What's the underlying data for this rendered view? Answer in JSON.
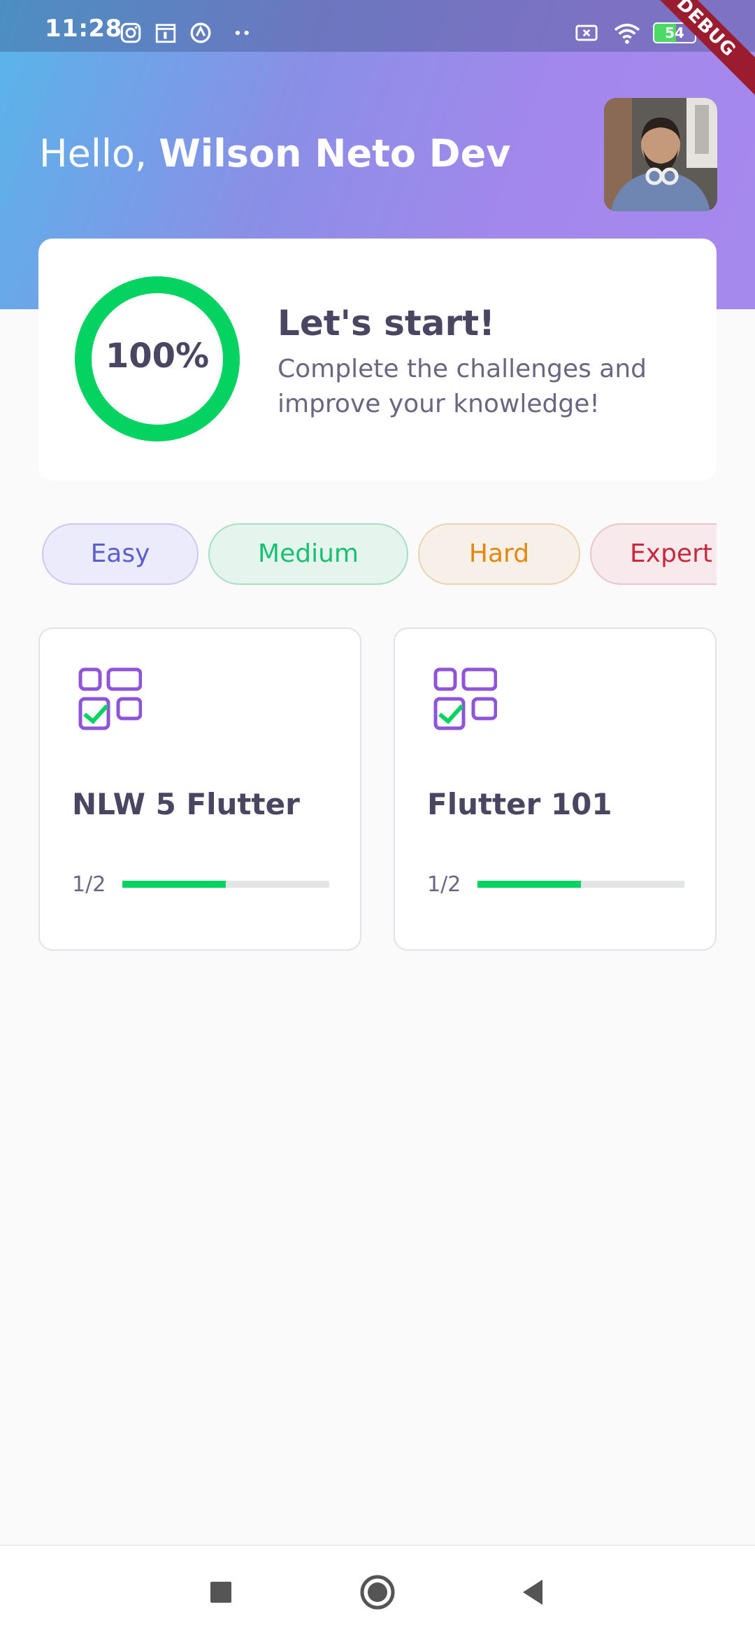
{
  "status_bar": {
    "time": "11:28",
    "battery": "54",
    "left_icons": [
      "instagram-icon",
      "calendar-icon",
      "vpn-icon",
      "more-dots-icon"
    ],
    "right_icons": [
      "sim-off-icon",
      "wifi-icon",
      "battery-icon"
    ]
  },
  "debug_banner": "DEBUG",
  "greeting": {
    "prefix": "Hello, ",
    "name": "Wilson Neto Dev"
  },
  "score_card": {
    "percent_label": "100%",
    "progress": 1.0,
    "title": "Let's start!",
    "subtitle": "Complete the challenges and improve your knowledge!"
  },
  "levels": [
    {
      "label": "Easy",
      "text_color": "#5a5fce",
      "bg_color": "#ebebfb",
      "border_color": "#c9c9f4"
    },
    {
      "label": "Medium",
      "text_color": "#16c172",
      "bg_color": "#e5f4ec",
      "border_color": "#a7dfc2"
    },
    {
      "label": "Hard",
      "text_color": "#e2880e",
      "bg_color": "#f6f0e8",
      "border_color": "#ecd3b2"
    },
    {
      "label": "Expert",
      "text_color": "#c8293c",
      "bg_color": "#f7e9ec",
      "border_color": "#ecc4cb"
    }
  ],
  "quizzes": [
    {
      "title": "NLW 5 Flutter",
      "progress_text": "1/2",
      "progress": 0.5,
      "icon": "quiz-checklist-icon"
    },
    {
      "title": "Flutter 101",
      "progress_text": "1/2",
      "progress": 0.5,
      "icon": "quiz-checklist-icon"
    }
  ],
  "nav": [
    "recents-square-icon",
    "home-circle-icon",
    "back-triangle-icon"
  ],
  "colors": {
    "accent_green": "#04d361",
    "heading": "#4a4560",
    "icon_purple": "#8e55d8"
  }
}
